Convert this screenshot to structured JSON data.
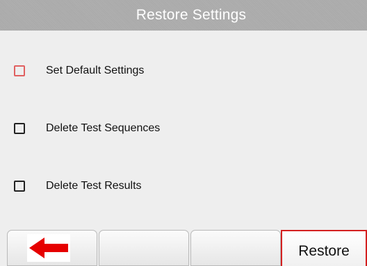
{
  "header": {
    "title": "Restore Settings"
  },
  "options": [
    {
      "label": "Set Default Settings",
      "checked": false,
      "focused": true
    },
    {
      "label": "Delete Test Sequences",
      "checked": false,
      "focused": false
    },
    {
      "label": "Delete Test Results",
      "checked": false,
      "focused": false
    }
  ],
  "softkeys": {
    "back_icon": "back-arrow-icon",
    "restore_label": "Restore"
  },
  "colors": {
    "back_arrow": "#e60000",
    "focus_outline": "#d42020",
    "focused_checkbox": "#e06060"
  }
}
